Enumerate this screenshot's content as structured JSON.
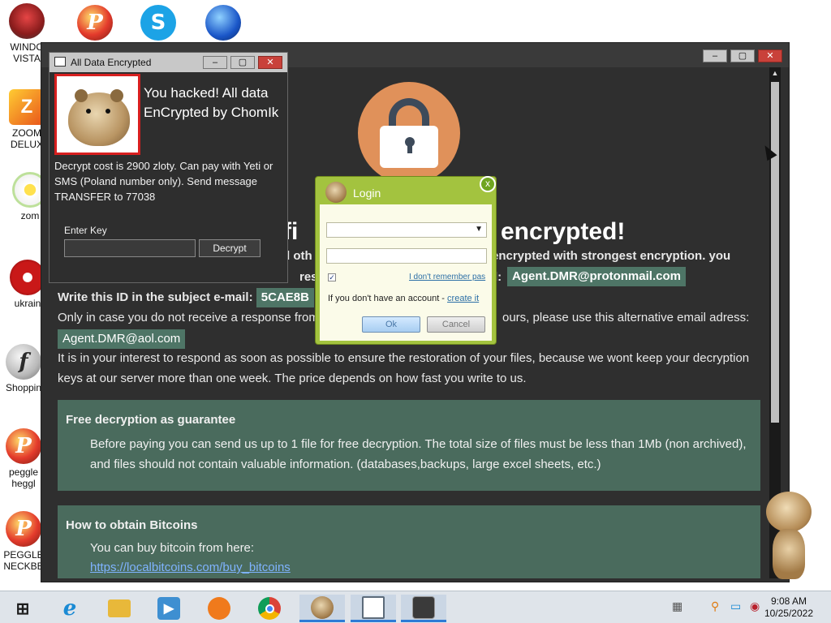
{
  "desktop": {
    "icons": [
      {
        "label": "WINDO\nVISTA",
        "icon": "windows-orb-icon"
      },
      {
        "label": "ZOOM\nDELUX",
        "icon": "zoom-deluxe-icon"
      },
      {
        "label": "zom",
        "icon": "flower-icon"
      },
      {
        "label": "ukrain",
        "icon": "radiation-icon"
      },
      {
        "label": "Shoppin",
        "icon": "flash-icon"
      },
      {
        "label": "peggle\nheggl",
        "icon": "peggle-icon"
      },
      {
        "label": "PEGGLE\nNECKBE",
        "icon": "peggle-icon"
      }
    ],
    "top_icons": [
      "peggle-icon",
      "skype-icon",
      "globe-icon"
    ]
  },
  "main_window": {
    "headline_left": "fi",
    "headline_right": "encrypted!",
    "line1_left": "d oth",
    "line1_right": "encrypted with strongest encryption. you",
    "line2_mid": "resto",
    "line2_right_label": "l:",
    "email_primary": "Agent.DMR@protonmail.com",
    "id_label": "Write this ID in the subject e-mail:",
    "id_value": "5CAE8B",
    "alt_line_left": "Only in case you do not receive a response from",
    "alt_line_right": "ours, please use this alternative email adress:",
    "email_alt": "Agent.DMR@aol.com",
    "interest_line1": "It is in your interest to respond as soon as possible to ensure the restoration of your files, because we wont keep your decryption",
    "interest_line2": "keys at our server more than one week. The price depends on how fast you write to us.",
    "guarantee_title": "Free decryption as guarantee",
    "guarantee_line1": "Before paying you can send us up to 1 file for free decryption. The total size of files must be less than 1Mb (non archived),",
    "guarantee_line2": "and files should not contain valuable information. (databases,backups, large excel sheets, etc.)",
    "bitcoin_title": "How to obtain Bitcoins",
    "bitcoin_line": "You can buy bitcoin from here:",
    "bitcoin_link": "https://localbitcoins.com/buy_bitcoins"
  },
  "chomik_window": {
    "title": "All Data Encrypted",
    "message": "You hacked! All data EnCrypted by ChomIk",
    "cost": "Decrypt cost is 2900 zloty. Can pay with Yeti or SMS (Poland number only). Send message TRANSFER to 77038",
    "enter_key_label": "Enter Key",
    "decrypt_button": "Decrypt"
  },
  "login_dialog": {
    "title": "Login",
    "close": "x",
    "forgot": "I don't remember pas",
    "no_account_text": "If you don't have an account -",
    "create_link": "create it",
    "ok": "Ok",
    "cancel": "Cancel",
    "remember_checked": true
  },
  "window_buttons": {
    "minimize": "–",
    "maximize": "▢",
    "close": "✕"
  },
  "taskbar": {
    "items": [
      "start",
      "internet-explorer",
      "file-explorer",
      "media-player",
      "uc-browser",
      "chrome",
      "chomik",
      "document",
      "lock-app"
    ],
    "active": [
      "chomik",
      "document",
      "lock-app"
    ],
    "clock_time": "9:08 AM",
    "clock_date": "10/25/2022"
  }
}
